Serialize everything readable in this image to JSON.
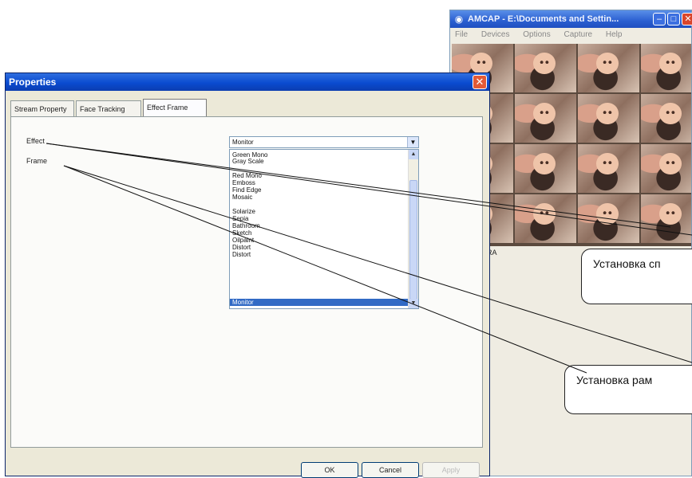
{
  "amcap_window": {
    "title": "AMCAP - E:\\Documents and Settin...",
    "app_icon": "camera-icon",
    "buttons": {
      "minimize": "–",
      "maximize": "□",
      "close": "✕"
    },
    "menu": [
      "File",
      "Devices",
      "Options",
      "Capture",
      "Help"
    ],
    "status_text": "PC CAMERA",
    "tile_count": 16
  },
  "properties_dialog": {
    "title": "Properties",
    "close_symbol": "✕",
    "tabs": [
      {
        "label": "Stream Property"
      },
      {
        "label": "Face Tracking"
      },
      {
        "label": "Effect Frame"
      }
    ],
    "effect_label": "Effect",
    "frame_label": "Frame",
    "effect_value": "Monitor",
    "dropdown_arrow": "▼",
    "scroll_up": "▲",
    "scroll_down": "▼",
    "effect_options": [
      "Green Mono",
      "Gray Scale",
      "Red Mono",
      "Emboss",
      "Find Edge",
      "Mosaic",
      "Solarize",
      "Sepia",
      "Bathroom",
      "Sketch",
      "Oilpaint",
      "Distort",
      "Distort",
      "Monitor"
    ],
    "selected_option": "Monitor",
    "buttons": {
      "ok": "OK",
      "cancel": "Cancel",
      "apply": "Apply"
    }
  },
  "annotations": {
    "effect_callout": "Установка сп",
    "frame_callout": "Установка рам"
  },
  "colors": {
    "xp_title_blue": "#0a4bd0",
    "selection_blue": "#316ac5",
    "close_red": "#e35a36"
  }
}
